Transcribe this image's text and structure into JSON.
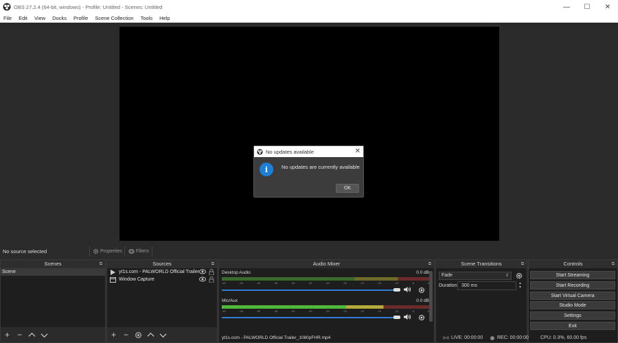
{
  "window": {
    "title": "OBS 27.2.4 (64-bit, windows) - Profile: Untitled - Scenes: Untitled",
    "minimize": "—",
    "maximize": "☐",
    "close": "✕"
  },
  "menu": [
    "File",
    "Edit",
    "View",
    "Docks",
    "Profile",
    "Scene Collection",
    "Tools",
    "Help"
  ],
  "dialog": {
    "title": "No updates available",
    "message": "No updates are currently available",
    "ok_label": "OK",
    "close": "✕",
    "info_glyph": "i"
  },
  "source_toolbar": {
    "status": "No source selected",
    "properties_label": "Properties",
    "filters_label": "Filters"
  },
  "scenes": {
    "title": "Scenes",
    "items": [
      "Scene"
    ]
  },
  "sources": {
    "title": "Sources",
    "items": [
      {
        "name": "yt1s.com - PALWORLD Official Trailer",
        "icon": "play-icon"
      },
      {
        "name": "Window Capture",
        "icon": "window-icon"
      }
    ]
  },
  "mixer": {
    "title": "Audio Mixer",
    "channels": [
      {
        "name": "Desktop Audio",
        "db": "0.0 dB",
        "volume": 1.0
      },
      {
        "name": "Mic/Aux",
        "db": "0.0 dB",
        "volume": 1.0
      }
    ],
    "ticks": [
      "-60",
      "-55",
      "-50",
      "-45",
      "-40",
      "-35",
      "-30",
      "-25",
      "-20",
      "-15",
      "-10",
      "-5",
      "0"
    ],
    "file_label": "yt1s.com - PALWORLD Official Trailer_1080pFHR.mp4"
  },
  "transitions": {
    "title": "Scene Transitions",
    "selected": "Fade",
    "duration_label": "Duration",
    "duration_value": "300 ms"
  },
  "controls": {
    "title": "Controls",
    "buttons": [
      "Start Streaming",
      "Start Recording",
      "Start Virtual Camera",
      "Studio Mode",
      "Settings",
      "Exit"
    ]
  },
  "status": {
    "live": "LIVE: 00:00:00",
    "rec": "REC: 00:00:00",
    "cpu": "CPU: 0.3%, 60.00 fps"
  },
  "dock_glyph": "⧉",
  "colors": {
    "background": "#2b2b2b",
    "dock": "#1e1e1e",
    "accent": "#2f7dd6",
    "info": "#1e7fd6"
  }
}
